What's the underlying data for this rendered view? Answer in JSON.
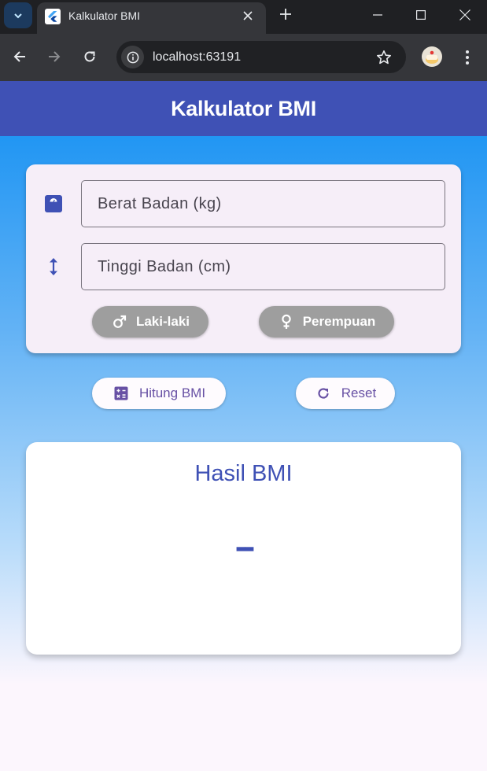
{
  "browser": {
    "tab_title": "Kalkulator BMI",
    "url": "localhost:63191",
    "icons": {
      "tab_search": "chevron-down-icon",
      "favicon": "flutter-icon",
      "tab_close": "close-icon",
      "new_tab": "plus-icon",
      "minimize": "minimize-icon",
      "maximize": "maximize-icon",
      "close_window": "close-icon",
      "back": "arrow-left-icon",
      "forward": "arrow-right-icon",
      "reload": "reload-icon",
      "site_info": "info-icon",
      "bookmark": "star-icon",
      "profile": "avatar",
      "menu": "more-vertical-icon"
    }
  },
  "app": {
    "title": "Kalkulator BMI",
    "inputs": {
      "weight_label": "Berat Badan (kg)",
      "weight_value": "",
      "height_label": "Tinggi Badan (cm)",
      "height_value": ""
    },
    "gender": {
      "male_label": "Laki-laki",
      "female_label": "Perempuan",
      "selected": ""
    },
    "actions": {
      "calculate_label": "Hitung BMI",
      "reset_label": "Reset"
    },
    "result": {
      "title": "Hasil BMI",
      "value": "--"
    }
  },
  "colors": {
    "primary": "#3f51b5",
    "gradient_top": "#2196f3",
    "gender_button": "#9e9e9e",
    "action_text": "#6750a4",
    "card_bg": "#f6eef8"
  }
}
